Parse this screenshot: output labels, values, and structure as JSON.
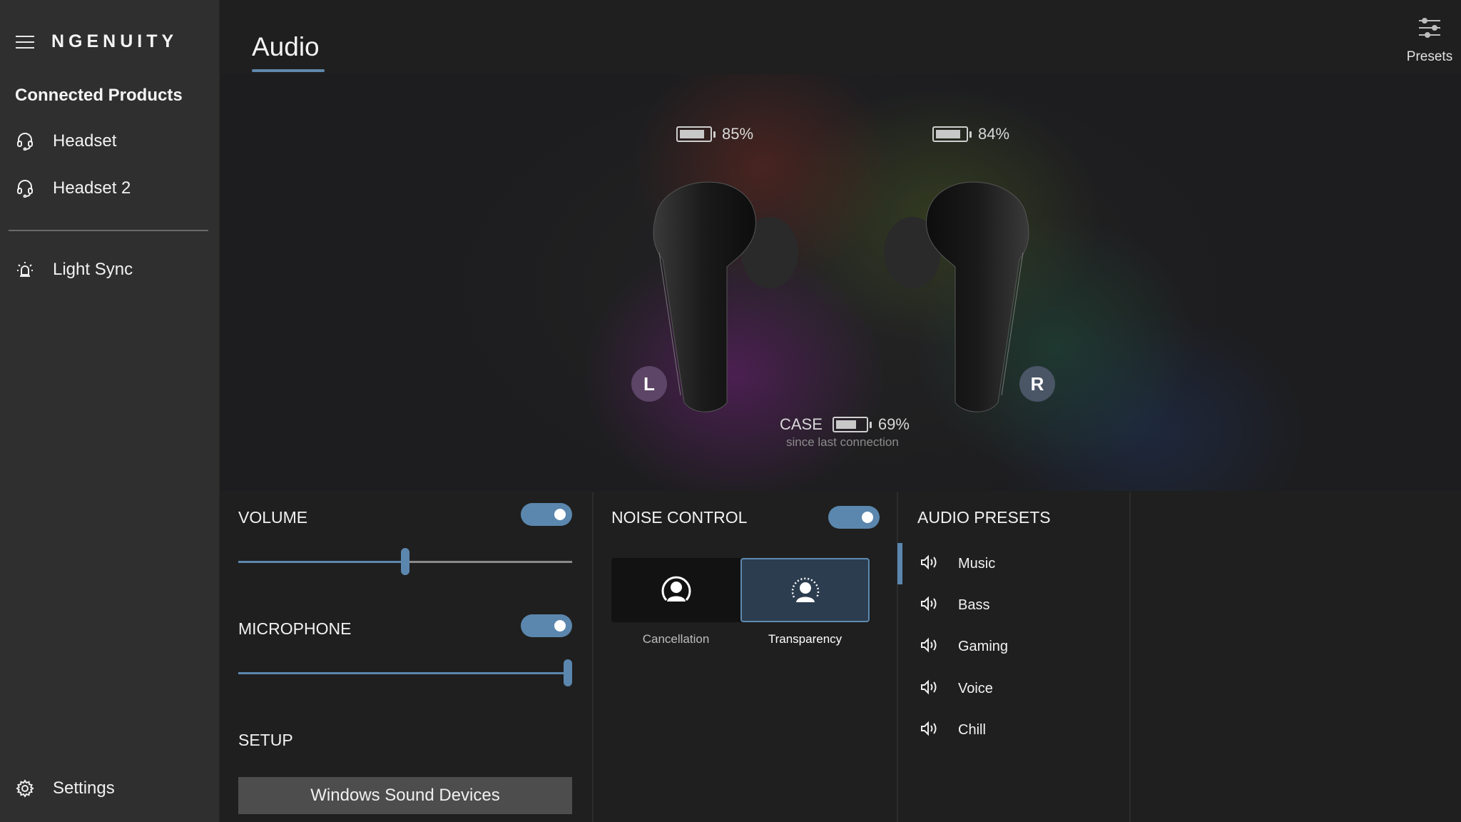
{
  "app": {
    "brand": "NGENUITY",
    "accent_color": "#5b87ae"
  },
  "sidebar": {
    "section_title": "Connected Products",
    "items": [
      {
        "label": "Headset",
        "icon": "headset-icon"
      },
      {
        "label": "Headset 2",
        "icon": "headset-icon"
      },
      {
        "label": "Light Sync",
        "icon": "light-icon"
      }
    ],
    "settings_label": "Settings"
  },
  "header": {
    "active_tab": "Audio",
    "presets_label": "Presets"
  },
  "device": {
    "left": {
      "badge": "L",
      "battery": "85%",
      "battery_level": 0.85
    },
    "right": {
      "badge": "R",
      "battery": "84%",
      "battery_level": 0.84
    },
    "case": {
      "label": "CASE",
      "battery": "69%",
      "battery_level": 0.69,
      "note": "since last connection"
    }
  },
  "volume_panel": {
    "volume_title": "VOLUME",
    "volume_enabled": true,
    "volume_level": 0.5,
    "microphone_title": "MICROPHONE",
    "microphone_enabled": true,
    "microphone_level": 1.0,
    "setup_title": "SETUP",
    "setup_button": "Windows Sound Devices"
  },
  "noise_panel": {
    "title": "NOISE CONTROL",
    "enabled": true,
    "options": [
      {
        "label": "Cancellation",
        "selected": false
      },
      {
        "label": "Transparency",
        "selected": true
      }
    ]
  },
  "presets_panel": {
    "title": "AUDIO PRESETS",
    "items": [
      "Music",
      "Bass",
      "Gaming",
      "Voice",
      "Chill"
    ],
    "selected": "Music"
  }
}
